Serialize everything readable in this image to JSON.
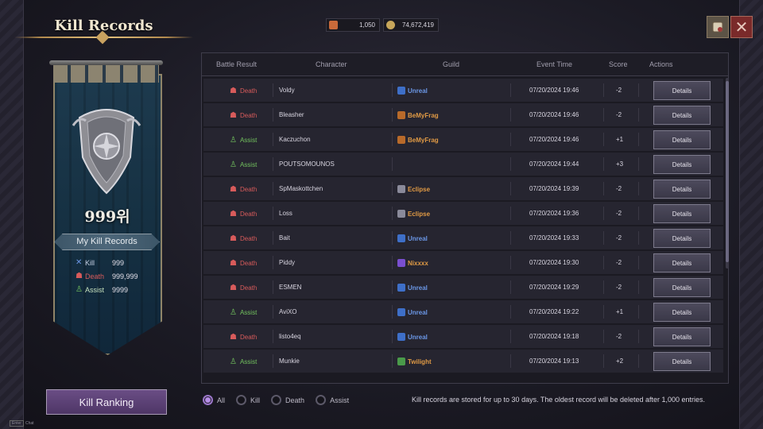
{
  "window": {
    "title": "Kill Records"
  },
  "currency": [
    {
      "icon": "ticket-icon",
      "value": "1,050"
    },
    {
      "icon": "coin-icon",
      "value": "74,672,419"
    }
  ],
  "profile": {
    "rank": "999위",
    "my_records_label": "My Kill Records",
    "stats": [
      {
        "icon": "crossed-swords-icon",
        "label": "Kill",
        "value": "999"
      },
      {
        "icon": "tombstone-icon",
        "label": "Death",
        "value": "999,999"
      },
      {
        "icon": "assist-person-icon",
        "label": "Assist",
        "value": "9999"
      }
    ]
  },
  "kill_ranking_label": "Kill Ranking",
  "enter_hint": {
    "key": "Enter",
    "label": "Chat"
  },
  "table": {
    "headers": [
      "Battle Result",
      "Character",
      "Guild",
      "Event Time",
      "Score",
      "Actions"
    ],
    "details_label": "Details",
    "rows": [
      {
        "result": "Death",
        "character": "Voldy",
        "guild": "Unreal",
        "time": "07/20/2024 19:46",
        "score": "-2"
      },
      {
        "result": "Death",
        "character": "Bleasher",
        "guild": "BeMyFrag",
        "time": "07/20/2024 19:46",
        "score": "-2"
      },
      {
        "result": "Assist",
        "character": "Kaczuchon",
        "guild": "BeMyFrag",
        "time": "07/20/2024 19:46",
        "score": "+1"
      },
      {
        "result": "Assist",
        "character": "POUTSOMOUNOS",
        "guild": "",
        "time": "07/20/2024 19:44",
        "score": "+3"
      },
      {
        "result": "Death",
        "character": "SpMaskottchen",
        "guild": "Eclipse",
        "time": "07/20/2024 19:39",
        "score": "-2"
      },
      {
        "result": "Death",
        "character": "Loss",
        "guild": "Eclipse",
        "time": "07/20/2024 19:36",
        "score": "-2"
      },
      {
        "result": "Death",
        "character": "Bait",
        "guild": "Unreal",
        "time": "07/20/2024 19:33",
        "score": "-2"
      },
      {
        "result": "Death",
        "character": "Piddy",
        "guild": "Nixxxx",
        "time": "07/20/2024 19:30",
        "score": "-2"
      },
      {
        "result": "Death",
        "character": "ESMEN",
        "guild": "Unreal",
        "time": "07/20/2024 19:29",
        "score": "-2"
      },
      {
        "result": "Assist",
        "character": "AviXO",
        "guild": "Unreal",
        "time": "07/20/2024 19:22",
        "score": "+1"
      },
      {
        "result": "Death",
        "character": "listo4eq",
        "guild": "Unreal",
        "time": "07/20/2024 19:18",
        "score": "-2"
      },
      {
        "result": "Assist",
        "character": "Munkie",
        "guild": "Twilight",
        "time": "07/20/2024 19:13",
        "score": "+2"
      }
    ]
  },
  "filters": [
    {
      "label": "All",
      "selected": true
    },
    {
      "label": "Kill",
      "selected": false
    },
    {
      "label": "Death",
      "selected": false
    },
    {
      "label": "Assist",
      "selected": false
    }
  ],
  "notice": "Kill records are stored for up to 30 days. The oldest record will be deleted after 1,000 entries.",
  "colors": {
    "death": "#d85b5b",
    "assist": "#72c25e",
    "unreal": "#6b97e6",
    "guild_other": "#e09a45",
    "accent": "#9a76c8"
  }
}
